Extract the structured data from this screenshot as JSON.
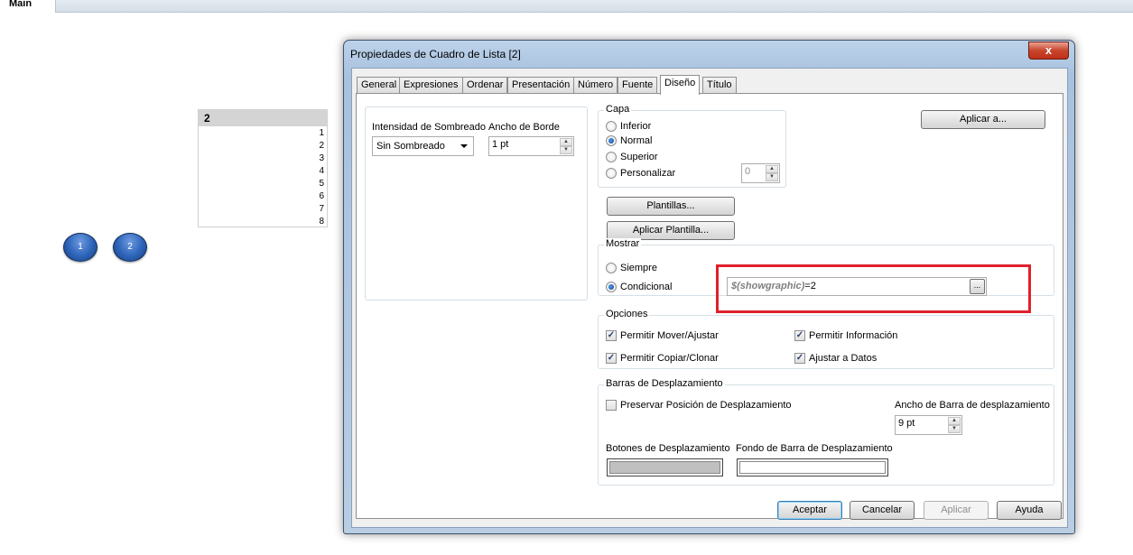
{
  "sheet": {
    "tab_label": "Main",
    "listbox": {
      "title": "2",
      "items": [
        "1",
        "2",
        "3",
        "4",
        "5",
        "6",
        "7",
        "8"
      ]
    },
    "buttons": [
      "1",
      "2"
    ]
  },
  "dialog": {
    "title": "Propiedades de Cuadro de Lista [2]",
    "close_symbol": "x",
    "tabs": [
      "General",
      "Expresiones",
      "Ordenar",
      "Presentación",
      "Número",
      "Fuente",
      "Diseño",
      "Título"
    ],
    "active_tab": "Diseño",
    "shading": {
      "label": "Intensidad de Sombreado",
      "value": "Sin Sombreado"
    },
    "border_width": {
      "label": "Ancho de Borde",
      "value": "1 pt"
    },
    "layer": {
      "label": "Capa",
      "options": [
        "Inferior",
        "Normal",
        "Superior",
        "Personalizar"
      ],
      "selected": "Normal",
      "custom_value": "0"
    },
    "apply_to_button": "Aplicar a...",
    "templates_button": "Plantillas...",
    "apply_template_button": "Aplicar Plantilla...",
    "show": {
      "label": "Mostrar",
      "options": [
        "Siempre",
        "Condicional"
      ],
      "selected": "Condicional",
      "condition_fn": "$(showgraphic)",
      "condition_rest": "=2",
      "ellipsis": "..."
    },
    "options": {
      "label": "Opciones",
      "items": [
        {
          "label": "Permitir Mover/Ajustar",
          "checked": true
        },
        {
          "label": "Permitir Información",
          "checked": true
        },
        {
          "label": "Permitir Copiar/Clonar",
          "checked": true
        },
        {
          "label": "Ajustar a Datos",
          "checked": true
        }
      ]
    },
    "scrollbars": {
      "label": "Barras de Desplazamiento",
      "preserve_label": "Preservar Posición de Desplazamiento",
      "preserve_checked": false,
      "width_label": "Ancho de Barra de desplazamiento",
      "width_value": "9 pt",
      "buttons_label": "Botones de Desplazamiento",
      "buttons_color": "#c0c0c0",
      "background_label": "Fondo de Barra de Desplazamiento",
      "background_color": "#ffffff"
    },
    "footer": {
      "ok": "Aceptar",
      "cancel": "Cancelar",
      "apply": "Aplicar",
      "help": "Ayuda"
    },
    "colors": {
      "highlight": "#e0202c",
      "titlebar": "#bcd2ea"
    }
  }
}
